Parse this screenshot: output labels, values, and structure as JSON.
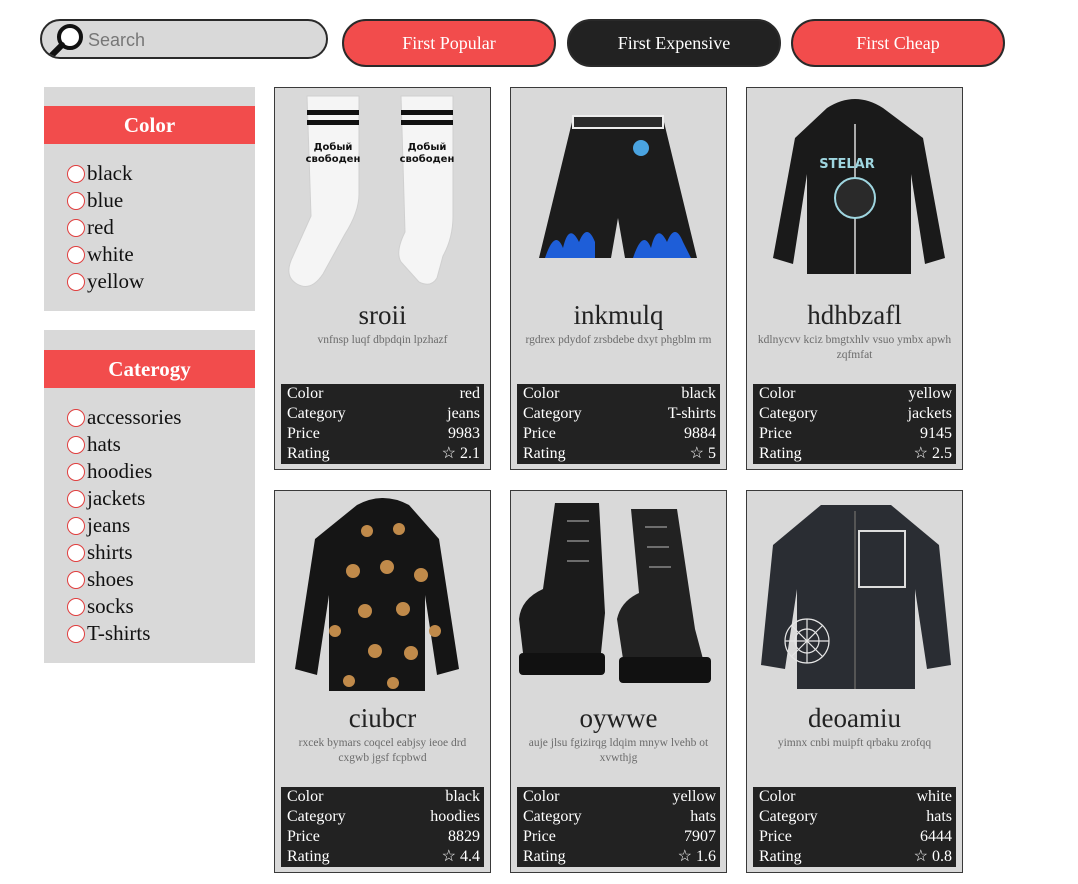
{
  "search": {
    "placeholder": "Search",
    "value": ""
  },
  "sort_buttons": [
    {
      "label": "First Popular",
      "active": false
    },
    {
      "label": "First Expensive",
      "active": true
    },
    {
      "label": "First Cheap",
      "active": false
    }
  ],
  "filters": {
    "color": {
      "title": "Color",
      "options": [
        "black",
        "blue",
        "red",
        "white",
        "yellow"
      ]
    },
    "category": {
      "title": "Caterogy",
      "options": [
        "accessories",
        "hats",
        "hoodies",
        "jackets",
        "jeans",
        "shirts",
        "shoes",
        "socks",
        "T-shirts"
      ]
    }
  },
  "spec_labels": {
    "color": "Color",
    "category": "Category",
    "price": "Price",
    "rating": "Rating"
  },
  "rating_icon": "☆",
  "products": [
    {
      "name": "sroii",
      "description": "vnfnsp luqf dbpdqin lpzhazf",
      "color": "red",
      "category": "jeans",
      "price": "9983",
      "rating": "☆ 2.1",
      "image": "socks-image",
      "print_text": [
        "Добый",
        "свободен"
      ]
    },
    {
      "name": "inkmulq",
      "description": "rgdrex pdydof zrsbdebe dxyt phgblm rm",
      "color": "black",
      "category": "T-shirts",
      "price": "9884",
      "rating": "☆ 5",
      "image": "shorts-image"
    },
    {
      "name": "hdhbzafl",
      "description": "kdlnycvv kciz bmgtxhlv vsuo ymbx apwh zqfmfat",
      "color": "yellow",
      "category": "jackets",
      "price": "9145",
      "rating": "☆ 2.5",
      "image": "hoodie-image",
      "print_text": [
        "STELAR"
      ]
    },
    {
      "name": "ciubcr",
      "description": "rxcek bymars coqcel eabjsy ieoe drd cxgwb jgsf fcpbwd",
      "color": "black",
      "category": "hoodies",
      "price": "8829",
      "rating": "☆ 4.4",
      "image": "teddy-jacket-image"
    },
    {
      "name": "oywwe",
      "description": "auje jlsu fgizirqg ldqim mnyw lvehb ot xvwthjg",
      "color": "yellow",
      "category": "hats",
      "price": "7907",
      "rating": "☆ 1.6",
      "image": "boots-image"
    },
    {
      "name": "deoamiu",
      "description": "yimnx cnbi muipft qrbaku zrofqq",
      "color": "white",
      "category": "hats",
      "price": "6444",
      "rating": "☆ 0.8",
      "image": "denim-jacket-image"
    }
  ],
  "colors": {
    "accent": "#f24c4c",
    "dark": "#222222",
    "panel": "#d9d9d9"
  }
}
